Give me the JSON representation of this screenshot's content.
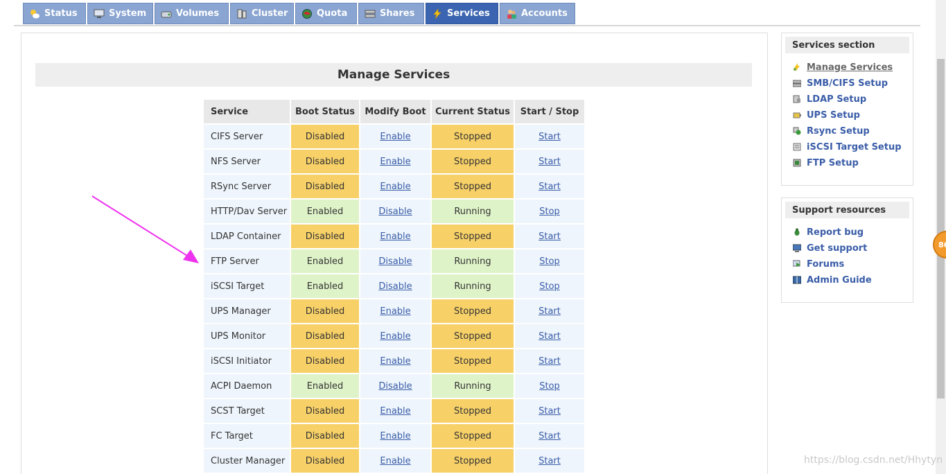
{
  "nav": {
    "tabs": [
      {
        "label": "Status",
        "icon": "sun-cloud-icon",
        "active": false
      },
      {
        "label": "System",
        "icon": "monitor-icon",
        "active": false
      },
      {
        "label": "Volumes",
        "icon": "disk-icon",
        "active": false
      },
      {
        "label": "Cluster",
        "icon": "servers-icon",
        "active": false
      },
      {
        "label": "Quota",
        "icon": "globe-icon",
        "active": false
      },
      {
        "label": "Shares",
        "icon": "drive-icon",
        "active": false
      },
      {
        "label": "Services",
        "icon": "lightning-icon",
        "active": true
      },
      {
        "label": "Accounts",
        "icon": "users-icon",
        "active": false
      }
    ]
  },
  "main": {
    "title": "Manage Services",
    "table": {
      "headers": [
        "Service",
        "Boot Status",
        "Modify Boot",
        "Current Status",
        "Start / Stop"
      ],
      "rows": [
        {
          "service": "CIFS Server",
          "boot": "Disabled",
          "modify": "Enable",
          "current": "Stopped",
          "action": "Start"
        },
        {
          "service": "NFS Server",
          "boot": "Disabled",
          "modify": "Enable",
          "current": "Stopped",
          "action": "Start"
        },
        {
          "service": "RSync Server",
          "boot": "Disabled",
          "modify": "Enable",
          "current": "Stopped",
          "action": "Start"
        },
        {
          "service": "HTTP/Dav Server",
          "boot": "Enabled",
          "modify": "Disable",
          "current": "Running",
          "action": "Stop"
        },
        {
          "service": "LDAP Container",
          "boot": "Disabled",
          "modify": "Enable",
          "current": "Stopped",
          "action": "Start"
        },
        {
          "service": "FTP Server",
          "boot": "Enabled",
          "modify": "Disable",
          "current": "Running",
          "action": "Stop"
        },
        {
          "service": "iSCSI Target",
          "boot": "Enabled",
          "modify": "Disable",
          "current": "Running",
          "action": "Stop"
        },
        {
          "service": "UPS Manager",
          "boot": "Disabled",
          "modify": "Enable",
          "current": "Stopped",
          "action": "Start"
        },
        {
          "service": "UPS Monitor",
          "boot": "Disabled",
          "modify": "Enable",
          "current": "Stopped",
          "action": "Start"
        },
        {
          "service": "iSCSI Initiator",
          "boot": "Disabled",
          "modify": "Enable",
          "current": "Stopped",
          "action": "Start"
        },
        {
          "service": "ACPI Daemon",
          "boot": "Enabled",
          "modify": "Disable",
          "current": "Running",
          "action": "Stop"
        },
        {
          "service": "SCST Target",
          "boot": "Disabled",
          "modify": "Enable",
          "current": "Stopped",
          "action": "Start"
        },
        {
          "service": "FC Target",
          "boot": "Disabled",
          "modify": "Enable",
          "current": "Stopped",
          "action": "Start"
        },
        {
          "service": "Cluster Manager",
          "boot": "Disabled",
          "modify": "Enable",
          "current": "Stopped",
          "action": "Start"
        }
      ]
    }
  },
  "sidebar": {
    "services": {
      "title": "Services section",
      "items": [
        {
          "label": "Manage Services",
          "icon": "services-icon",
          "current": true
        },
        {
          "label": "SMB/CIFS Setup",
          "icon": "drive-icon",
          "current": false
        },
        {
          "label": "LDAP Setup",
          "icon": "book-icon",
          "current": false
        },
        {
          "label": "UPS Setup",
          "icon": "battery-icon",
          "current": false
        },
        {
          "label": "Rsync Setup",
          "icon": "sync-icon",
          "current": false
        },
        {
          "label": "iSCSI Target Setup",
          "icon": "target-icon",
          "current": false
        },
        {
          "label": "FTP Setup",
          "icon": "ftp-icon",
          "current": false
        }
      ]
    },
    "support": {
      "title": "Support resources",
      "items": [
        {
          "label": "Report bug",
          "icon": "bug-icon"
        },
        {
          "label": "Get support",
          "icon": "support-icon"
        },
        {
          "label": "Forums",
          "icon": "forum-icon"
        },
        {
          "label": "Admin Guide",
          "icon": "guide-icon"
        }
      ]
    }
  },
  "overlay": {
    "badge_text": "86",
    "watermark": "https://blog.csdn.net/Hhytyn"
  },
  "colors": {
    "tab": "#8aa5d1",
    "tab_active": "#3c65b1",
    "disabled_cell": "#f7d067",
    "enabled_cell": "#dff3c8",
    "link": "#3a5da8",
    "arrow": "#ee33ee"
  }
}
